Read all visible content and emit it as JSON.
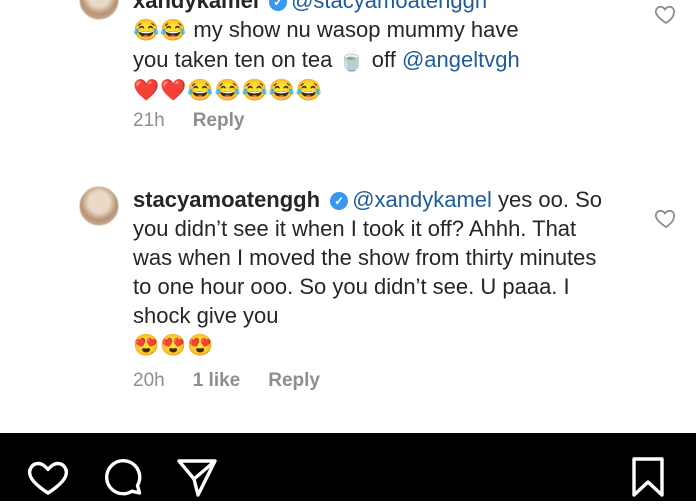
{
  "comments": [
    {
      "username_partial": "xandykamel",
      "mention_partial": "@stacyamoatenggh",
      "line1_emojis": "😂😂",
      "line1_text": " my show nu wasop  mummy have",
      "line2_text": "you taken ten on tea ",
      "line2_emoji": "🍵",
      "line2_text_after": " off ",
      "mention_end": "@angeltvgh",
      "line3_emojis": "❤️❤️😂😂😂😂😂",
      "time": "21h",
      "reply_label": "Reply"
    },
    {
      "username": "stacyamoatenggh",
      "verified_mark": "✓",
      "mention": "@xandykamel",
      "text": " yes oo. So you didn’t see it when I took it off? Ahhh. That was when I moved the show from thirty minutes to one hour ooo. So you didn’t see. U paaa. I shock give you",
      "emojis": "😍😍😍",
      "time": "20h",
      "likes": "1 like",
      "reply_label": "Reply"
    }
  ],
  "icons": {
    "heart": "heart-icon",
    "comment": "comment-icon",
    "share": "share-icon",
    "save": "bookmark-icon"
  },
  "colors": {
    "mention": "#1f5b9a",
    "verified": "#3897f0",
    "meta": "#8e8e8e",
    "bar": "#000000"
  }
}
